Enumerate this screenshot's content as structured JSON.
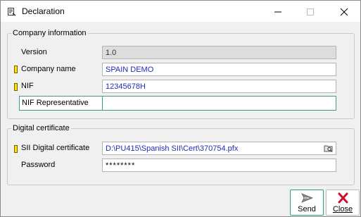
{
  "window": {
    "title": "Declaration",
    "icons": {
      "app": "document-icon",
      "minimize": "minimize-icon",
      "maximize": "maximize-icon",
      "close": "close-icon"
    }
  },
  "company": {
    "legend": "Company information",
    "version_label": "Version",
    "version_value": "1.0",
    "name_label": "Company name",
    "name_value": "SPAIN DEMO",
    "nif_label": "NIF",
    "nif_value": "12345678H",
    "nif_rep_label": "NIF Representative",
    "nif_rep_value": ""
  },
  "certificate": {
    "legend": "Digital certificate",
    "cert_label": "SII Digital certificate",
    "cert_value": "D:\\PU415\\Spanish SII\\Cert\\370754.pfx",
    "browse_icon": "folder-search-icon",
    "password_label": "Password",
    "password_value": "********"
  },
  "actions": {
    "send_label": "Send",
    "send_icon": "send-icon",
    "close_label": "Close",
    "close_icon": "close-x-icon"
  },
  "colors": {
    "required_marker": "#ffe200",
    "value_text": "#1f2bb5",
    "focus_border": "#3c9c8a",
    "close_icon": "#c8102e"
  }
}
